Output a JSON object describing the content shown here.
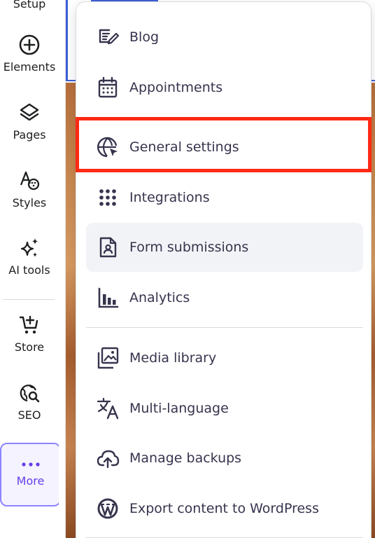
{
  "sidebar": {
    "items": [
      {
        "label": "Setup",
        "icon": "setup-icon"
      },
      {
        "label": "Elements",
        "icon": "plus-circle-icon"
      },
      {
        "label": "Pages",
        "icon": "layers-icon"
      },
      {
        "label": "Styles",
        "icon": "palette-icon"
      },
      {
        "label": "AI tools",
        "icon": "sparkles-icon"
      },
      {
        "label": "Store",
        "icon": "cart-icon"
      },
      {
        "label": "SEO",
        "icon": "seo-globe-icon"
      },
      {
        "label": "More",
        "icon": "more-dots-icon",
        "active": true
      }
    ]
  },
  "menu": {
    "items": [
      {
        "label": "Blog",
        "icon": "blog-icon"
      },
      {
        "label": "Appointments",
        "icon": "calendar-icon"
      },
      {
        "label": "General settings",
        "icon": "globe-cursor-icon",
        "highlighted": true
      },
      {
        "label": "Integrations",
        "icon": "grid-dots-icon"
      },
      {
        "label": "Form submissions",
        "icon": "form-document-icon",
        "hovered": true
      },
      {
        "label": "Analytics",
        "icon": "bar-chart-icon"
      },
      {
        "label": "Media library",
        "icon": "image-stack-icon"
      },
      {
        "label": "Multi-language",
        "icon": "translate-icon"
      },
      {
        "label": "Manage backups",
        "icon": "cloud-upload-icon"
      },
      {
        "label": "Export content to WordPress",
        "icon": "wordpress-icon"
      }
    ]
  },
  "colors": {
    "accent": "#673de6",
    "highlight": "#ff2a14",
    "text": "#1d1e20",
    "menu_text": "#36344d",
    "hover_bg": "#f2f3f6"
  }
}
